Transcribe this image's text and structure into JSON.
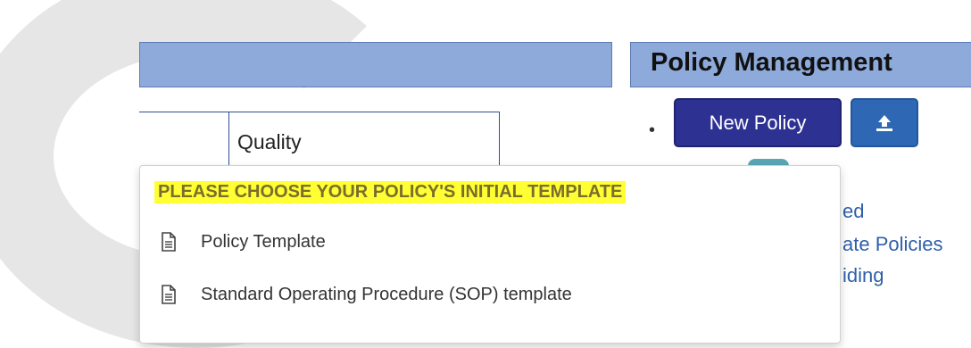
{
  "policy_panel": {
    "title": "Policy Management",
    "new_policy_label": "New Policy",
    "upload_icon": "upload-icon",
    "partial_links": [
      "ed",
      "ate Policies",
      "iding"
    ]
  },
  "left_table": {
    "cell_label": "Quality"
  },
  "template_menu": {
    "header": "PLEASE CHOOSE YOUR POLICY'S INITIAL TEMPLATE",
    "items": [
      {
        "label": "Policy Template",
        "icon": "document-icon"
      },
      {
        "label": "Standard Operating Procedure (SOP) template",
        "icon": "document-icon"
      }
    ]
  },
  "colors": {
    "header_band": "#8eaadb",
    "new_policy_button": "#2d3192",
    "upload_button": "#2e68b5",
    "highlight": "#ffff33"
  }
}
